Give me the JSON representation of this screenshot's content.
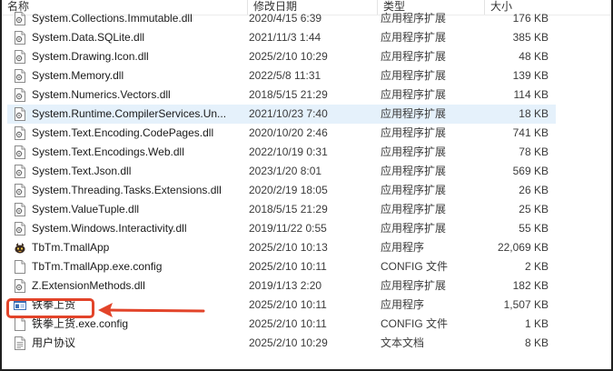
{
  "columns": {
    "name": "名称",
    "date": "修改日期",
    "type": "类型",
    "size": "大小"
  },
  "files": [
    {
      "name": "System.Collections.Immutable.dll",
      "date": "2020/4/15 6:39",
      "type": "应用程序扩展",
      "size": "176 KB",
      "icon": "dll-file-icon"
    },
    {
      "name": "System.Data.SQLite.dll",
      "date": "2021/11/3 1:44",
      "type": "应用程序扩展",
      "size": "385 KB",
      "icon": "dll-file-icon"
    },
    {
      "name": "System.Drawing.Icon.dll",
      "date": "2025/2/10 10:29",
      "type": "应用程序扩展",
      "size": "48 KB",
      "icon": "dll-file-icon"
    },
    {
      "name": "System.Memory.dll",
      "date": "2022/5/8 11:31",
      "type": "应用程序扩展",
      "size": "139 KB",
      "icon": "dll-file-icon"
    },
    {
      "name": "System.Numerics.Vectors.dll",
      "date": "2018/5/15 21:29",
      "type": "应用程序扩展",
      "size": "114 KB",
      "icon": "dll-file-icon"
    },
    {
      "name": "System.Runtime.CompilerServices.Un...",
      "date": "2021/10/23 7:40",
      "type": "应用程序扩展",
      "size": "18 KB",
      "icon": "dll-file-icon",
      "selected": true
    },
    {
      "name": "System.Text.Encoding.CodePages.dll",
      "date": "2020/10/20 2:46",
      "type": "应用程序扩展",
      "size": "741 KB",
      "icon": "dll-file-icon"
    },
    {
      "name": "System.Text.Encodings.Web.dll",
      "date": "2022/10/19 0:31",
      "type": "应用程序扩展",
      "size": "78 KB",
      "icon": "dll-file-icon"
    },
    {
      "name": "System.Text.Json.dll",
      "date": "2023/1/20 8:01",
      "type": "应用程序扩展",
      "size": "569 KB",
      "icon": "dll-file-icon"
    },
    {
      "name": "System.Threading.Tasks.Extensions.dll",
      "date": "2020/2/19 18:05",
      "type": "应用程序扩展",
      "size": "26 KB",
      "icon": "dll-file-icon"
    },
    {
      "name": "System.ValueTuple.dll",
      "date": "2018/5/15 21:29",
      "type": "应用程序扩展",
      "size": "25 KB",
      "icon": "dll-file-icon"
    },
    {
      "name": "System.Windows.Interactivity.dll",
      "date": "2019/11/22 0:55",
      "type": "应用程序扩展",
      "size": "55 KB",
      "icon": "dll-file-icon"
    },
    {
      "name": "TbTm.TmallApp",
      "date": "2025/2/10 10:13",
      "type": "应用程序",
      "size": "22,069 KB",
      "icon": "app-exe-icon"
    },
    {
      "name": "TbTm.TmallApp.exe.config",
      "date": "2025/2/10 10:11",
      "type": "CONFIG 文件",
      "size": "2 KB",
      "icon": "blank-file-icon"
    },
    {
      "name": "Z.ExtensionMethods.dll",
      "date": "2019/1/13 2:20",
      "type": "应用程序扩展",
      "size": "182 KB",
      "icon": "dll-file-icon"
    },
    {
      "name": "铁拳上货",
      "date": "2025/2/10 10:11",
      "type": "应用程序",
      "size": "1,507 KB",
      "icon": "window-app-icon"
    },
    {
      "name": "铁拳上货.exe.config",
      "date": "2025/2/10 10:11",
      "type": "CONFIG 文件",
      "size": "1 KB",
      "icon": "blank-file-icon"
    },
    {
      "name": "用户协议",
      "date": "2025/2/10 10:29",
      "type": "文本文档",
      "size": "8 KB",
      "icon": "text-file-icon"
    }
  ],
  "colors": {
    "selection": "#e5f1fb",
    "annotation": "#e2442a"
  }
}
